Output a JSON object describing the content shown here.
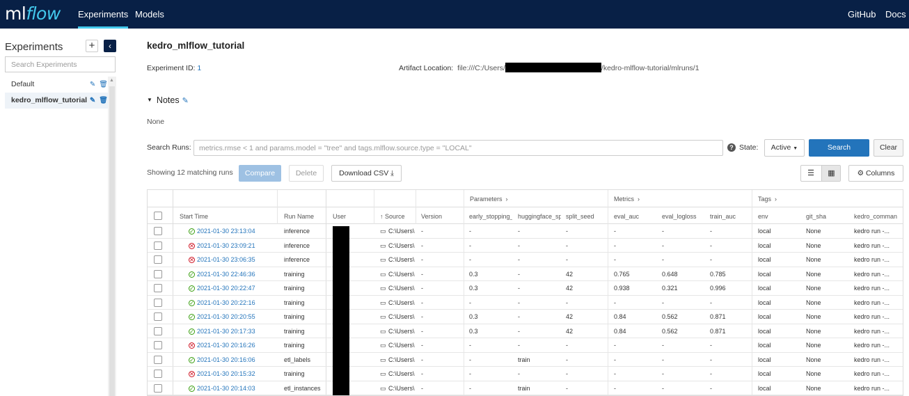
{
  "nav": {
    "logo_ml": "ml",
    "logo_flow": "flow",
    "experiments": "Experiments",
    "models": "Models",
    "github": "GitHub",
    "docs": "Docs"
  },
  "sidebar": {
    "title": "Experiments",
    "plus": "+",
    "collapse": "‹",
    "search_placeholder": "Search Experiments",
    "items": [
      {
        "label": "Default"
      },
      {
        "label": "kedro_mlflow_tutorial"
      }
    ]
  },
  "experiment": {
    "title": "kedro_mlflow_tutorial",
    "id_label": "Experiment ID",
    "id_value": "1",
    "artifact_label": "Artifact Location",
    "artifact_prefix": "file:///C:/Users/",
    "artifact_suffix": "/kedro-mlflow-tutorial/mlruns/1",
    "notes_label": "Notes",
    "notes_value": "None"
  },
  "search": {
    "label": "Search Runs:",
    "placeholder": "metrics.rmse < 1 and params.model = \"tree\" and tags.mlflow.source.type = \"LOCAL\"",
    "state_label": "State:",
    "state_value": "Active",
    "search_button": "Search",
    "clear_button": "Clear"
  },
  "toolbar": {
    "showing": "Showing 12 matching runs",
    "compare": "Compare",
    "delete": "Delete",
    "download": "Download CSV",
    "columns": "Columns"
  },
  "table": {
    "groups": {
      "parameters": "Parameters",
      "metrics": "Metrics",
      "tags": "Tags"
    },
    "headers": {
      "start_time": "Start Time",
      "run_name": "Run Name",
      "user": "User",
      "source": "Source",
      "version": "Version",
      "p1": "early_stopping_",
      "p2": "huggingface_sp",
      "p3": "split_seed",
      "m1": "eval_auc",
      "m2": "eval_logloss",
      "m3": "train_auc",
      "t1": "env",
      "t2": "git_sha",
      "t3": "kedro_comman"
    },
    "rows": [
      {
        "status": "ok",
        "time": "2021-01-30 23:13:04",
        "name": "inference",
        "source": "C:\\Users\\",
        "version": "-",
        "p1": "-",
        "p2": "-",
        "p3": "-",
        "m1": "-",
        "m2": "-",
        "m3": "-",
        "env": "local",
        "sha": "None",
        "cmd": "kedro run -..."
      },
      {
        "status": "fail",
        "time": "2021-01-30 23:09:21",
        "name": "inference",
        "source": "C:\\Users\\",
        "version": "-",
        "p1": "-",
        "p2": "-",
        "p3": "-",
        "m1": "-",
        "m2": "-",
        "m3": "-",
        "env": "local",
        "sha": "None",
        "cmd": "kedro run -..."
      },
      {
        "status": "fail",
        "time": "2021-01-30 23:06:35",
        "name": "inference",
        "source": "C:\\Users\\",
        "version": "-",
        "p1": "-",
        "p2": "-",
        "p3": "-",
        "m1": "-",
        "m2": "-",
        "m3": "-",
        "env": "local",
        "sha": "None",
        "cmd": "kedro run -..."
      },
      {
        "status": "ok",
        "time": "2021-01-30 22:46:36",
        "name": "training",
        "source": "C:\\Users\\",
        "version": "-",
        "p1": "0.3",
        "p2": "-",
        "p3": "42",
        "m1": "0.765",
        "m2": "0.648",
        "m3": "0.785",
        "env": "local",
        "sha": "None",
        "cmd": "kedro run -..."
      },
      {
        "status": "ok",
        "time": "2021-01-30 20:22:47",
        "name": "training",
        "source": "C:\\Users\\",
        "version": "-",
        "p1": "0.3",
        "p2": "-",
        "p3": "42",
        "m1": "0.938",
        "m2": "0.321",
        "m3": "0.996",
        "env": "local",
        "sha": "None",
        "cmd": "kedro run -..."
      },
      {
        "status": "ok",
        "time": "2021-01-30 20:22:16",
        "name": "training",
        "source": "C:\\Users\\",
        "version": "-",
        "p1": "-",
        "p2": "-",
        "p3": "-",
        "m1": "-",
        "m2": "-",
        "m3": "-",
        "env": "local",
        "sha": "None",
        "cmd": "kedro run -..."
      },
      {
        "status": "ok",
        "time": "2021-01-30 20:20:55",
        "name": "training",
        "source": "C:\\Users\\",
        "version": "-",
        "p1": "0.3",
        "p2": "-",
        "p3": "42",
        "m1": "0.84",
        "m2": "0.562",
        "m3": "0.871",
        "env": "local",
        "sha": "None",
        "cmd": "kedro run -..."
      },
      {
        "status": "ok",
        "time": "2021-01-30 20:17:33",
        "name": "training",
        "source": "C:\\Users\\",
        "version": "-",
        "p1": "0.3",
        "p2": "-",
        "p3": "42",
        "m1": "0.84",
        "m2": "0.562",
        "m3": "0.871",
        "env": "local",
        "sha": "None",
        "cmd": "kedro run -..."
      },
      {
        "status": "fail",
        "time": "2021-01-30 20:16:26",
        "name": "training",
        "source": "C:\\Users\\",
        "version": "-",
        "p1": "-",
        "p2": "-",
        "p3": "-",
        "m1": "-",
        "m2": "-",
        "m3": "-",
        "env": "local",
        "sha": "None",
        "cmd": "kedro run -..."
      },
      {
        "status": "ok",
        "time": "2021-01-30 20:16:06",
        "name": "etl_labels",
        "source": "C:\\Users\\",
        "version": "-",
        "p1": "-",
        "p2": "train",
        "p3": "-",
        "m1": "-",
        "m2": "-",
        "m3": "-",
        "env": "local",
        "sha": "None",
        "cmd": "kedro run -..."
      },
      {
        "status": "fail",
        "time": "2021-01-30 20:15:32",
        "name": "training",
        "source": "C:\\Users\\",
        "version": "-",
        "p1": "-",
        "p2": "-",
        "p3": "-",
        "m1": "-",
        "m2": "-",
        "m3": "-",
        "env": "local",
        "sha": "None",
        "cmd": "kedro run -..."
      },
      {
        "status": "ok",
        "time": "2021-01-30 20:14:03",
        "name": "etl_instances",
        "source": "C:\\Users\\",
        "version": "-",
        "p1": "-",
        "p2": "train",
        "p3": "-",
        "m1": "-",
        "m2": "-",
        "m3": "-",
        "env": "local",
        "sha": "None",
        "cmd": "kedro run -..."
      }
    ]
  },
  "colors": {
    "nav_bg": "#082046",
    "accent": "#43c9ed",
    "primary": "#2374bb",
    "success": "#389e0d",
    "fail": "#cf1322"
  }
}
